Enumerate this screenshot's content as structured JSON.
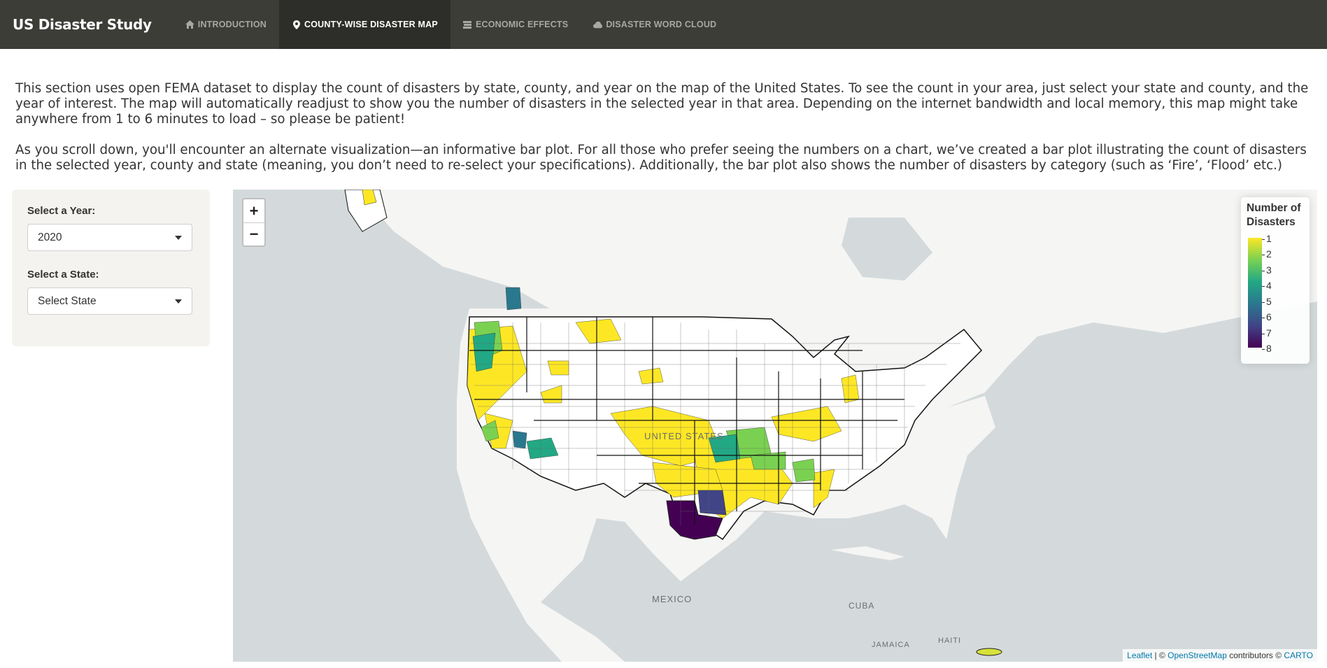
{
  "app": {
    "title": "US Disaster Study"
  },
  "nav": {
    "tabs": [
      {
        "label": "INTRODUCTION",
        "icon": "home-icon",
        "active": false
      },
      {
        "label": "COUNTY-WISE DISASTER MAP",
        "icon": "map-marker-icon",
        "active": true
      },
      {
        "label": "ECONOMIC EFFECTS",
        "icon": "money-icon",
        "active": false
      },
      {
        "label": "DISASTER WORD CLOUD",
        "icon": "cloud-icon",
        "active": false
      }
    ]
  },
  "intro": {
    "p1": "This section uses open FEMA dataset to display the count of disasters by state, county, and year on the map of the United States. To see the count in your area, just select your state and county, and the year of interest. The map will automatically readjust to show you the number of disasters in the selected year in that area. Depending on the internet bandwidth and local memory, this map might take anywhere from 1 to 6 minutes to load – so please be patient!",
    "p2": "As you scroll down, you'll encounter an alternate visualization—an informative bar plot. For all those who prefer seeing the numbers on a chart, we’ve created a bar plot illustrating the count of disasters in the selected year, county and state (meaning, you don’t need to re-select your specifications). Additionally, the bar plot also shows the number of disasters by category (such as ‘Fire’, ‘Flood’ etc.)"
  },
  "filters": {
    "year_label": "Select a Year:",
    "year_value": "2020",
    "state_label": "Select a State:",
    "state_value": "Select State"
  },
  "map": {
    "zoom_in": "+",
    "zoom_out": "−",
    "legend": {
      "title": "Number of Disasters",
      "ticks": [
        "1",
        "2",
        "3",
        "4",
        "5",
        "6",
        "7",
        "8"
      ],
      "colors": [
        "#fde725",
        "#7ad151",
        "#22a884",
        "#2a788e",
        "#414487",
        "#440154"
      ]
    },
    "labels": {
      "country": "UNITED STATES",
      "mexico": "MEXICO",
      "cuba": "CUBA",
      "jamaica": "JAMAICA",
      "haiti": "HAITI"
    },
    "attribution": {
      "leaflet": "Leaflet",
      "sep": " | © ",
      "osm": "OpenStreetMap",
      "contrib": " contributors © ",
      "carto": "CARTO"
    }
  }
}
